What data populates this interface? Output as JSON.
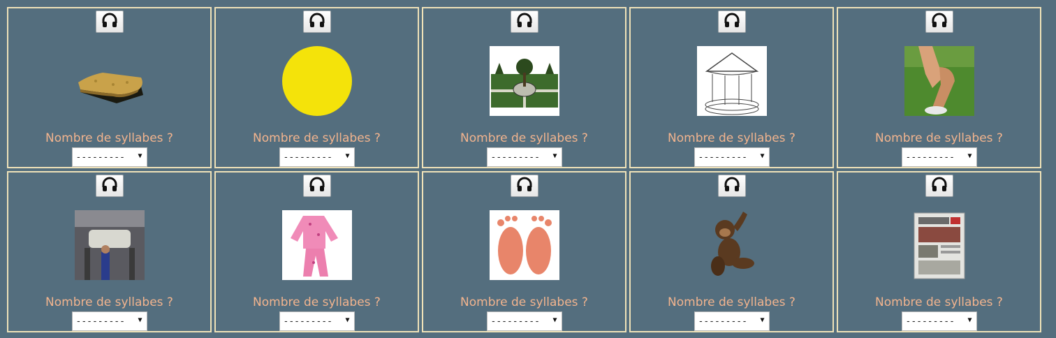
{
  "question_label": "Nombre de syllabes ?",
  "select_placeholder": "---------",
  "cells": [
    {
      "image": "sponge"
    },
    {
      "image": "sun"
    },
    {
      "image": "garden"
    },
    {
      "image": "carousel"
    },
    {
      "image": "knee"
    },
    {
      "image": "garage"
    },
    {
      "image": "pajamas"
    },
    {
      "image": "feet"
    },
    {
      "image": "monkey"
    },
    {
      "image": "newspaper"
    }
  ],
  "colors": {
    "background": "#546e7e",
    "cell_border": "#efe2b8",
    "question_text": "#f2b48e"
  }
}
